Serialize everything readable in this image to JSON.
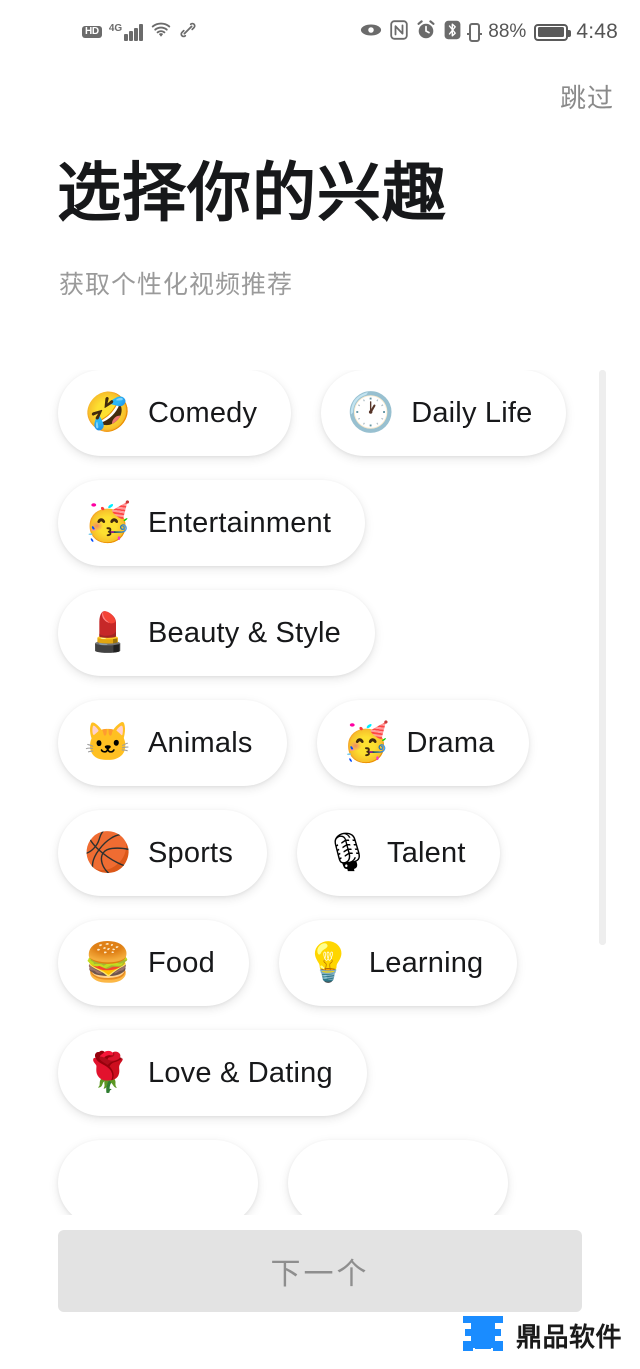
{
  "status_bar": {
    "hd_label": "HD",
    "network_label": "4G",
    "signal_icon": "signal-bars-icon",
    "wifi_icon": "wifi-icon",
    "link_icon": "link-icon",
    "eye_icon": "eye-icon",
    "nfc_icon": "nfc-icon",
    "alarm_icon": "alarm-clock-icon",
    "bluetooth_icon": "bluetooth-icon",
    "second_battery_icon": "secondary-battery-icon",
    "battery_percent": "88%",
    "battery_icon": "battery-icon",
    "time": "4:48"
  },
  "header": {
    "skip_label": "跳过",
    "title": "选择你的兴趣",
    "subtitle": "获取个性化视频推荐"
  },
  "interests": [
    {
      "emoji": "🤣",
      "emoji_name": "rolling-on-the-floor-laughing-emoji",
      "label": "Comedy"
    },
    {
      "emoji": "🕐",
      "emoji_name": "clock-emoji",
      "label": "Daily Life"
    },
    {
      "emoji": "🥳",
      "emoji_name": "partying-face-emoji",
      "label": "Entertainment"
    },
    {
      "emoji": "💄",
      "emoji_name": "lipstick-emoji",
      "label": "Beauty & Style"
    },
    {
      "emoji": "🐱",
      "emoji_name": "cat-face-emoji",
      "label": "Animals"
    },
    {
      "emoji": "🥳",
      "emoji_name": "partying-face-emoji",
      "label": "Drama"
    },
    {
      "emoji": "🏀",
      "emoji_name": "basketball-emoji",
      "label": "Sports"
    },
    {
      "emoji": "🎙",
      "emoji_name": "studio-microphone-emoji",
      "label": "Talent"
    },
    {
      "emoji": "🍔",
      "emoji_name": "hamburger-emoji",
      "label": "Food"
    },
    {
      "emoji": "💡",
      "emoji_name": "light-bulb-emoji",
      "label": "Learning"
    },
    {
      "emoji": "🌹",
      "emoji_name": "rose-emoji",
      "label": "Love & Dating"
    },
    {
      "emoji": "",
      "emoji_name": "hidden-emoji",
      "label": ""
    },
    {
      "emoji": "",
      "emoji_name": "hidden-emoji",
      "label": ""
    }
  ],
  "footer": {
    "next_label": "下一个"
  },
  "watermark": {
    "text": "鼎品软件",
    "logo_color": "#1a8cff"
  },
  "colors": {
    "background": "#ffffff",
    "title_text": "#17181a",
    "subtitle_text": "#9a9a9a",
    "skip_text": "#8a8a8a",
    "chip_background": "#ffffff",
    "next_button_bg": "#e3e3e3",
    "next_button_text": "#8e8e8e",
    "scrollbar": "#eeeeee",
    "status_icon": "#6b6b6b"
  }
}
